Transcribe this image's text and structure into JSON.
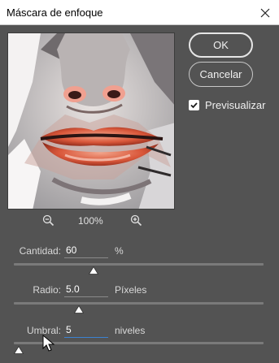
{
  "window": {
    "title": "Máscara de enfoque"
  },
  "buttons": {
    "ok": "OK",
    "cancel": "Cancelar"
  },
  "preview": {
    "label": "Previsualizar",
    "checked": true
  },
  "zoom": {
    "level": "100%"
  },
  "params": {
    "amount": {
      "label": "Cantidad:",
      "value": "60",
      "unit": "%",
      "slider_fraction": 0.32
    },
    "radius": {
      "label": "Radio:",
      "value": "5.0",
      "unit": "Píxeles",
      "slider_fraction": 0.26
    },
    "threshold": {
      "label": "Umbral:",
      "value": "5",
      "unit": "niveles",
      "slider_fraction": 0.02
    }
  },
  "colors": {
    "dialog_bg": "#535353",
    "focus_blue": "#3c82d2",
    "titlebar": "#ffffff"
  },
  "icons": [
    "close-icon",
    "zoom-out-icon",
    "zoom-in-icon",
    "checkmark-icon",
    "slider-thumb-icon",
    "mouse-cursor-icon"
  ]
}
